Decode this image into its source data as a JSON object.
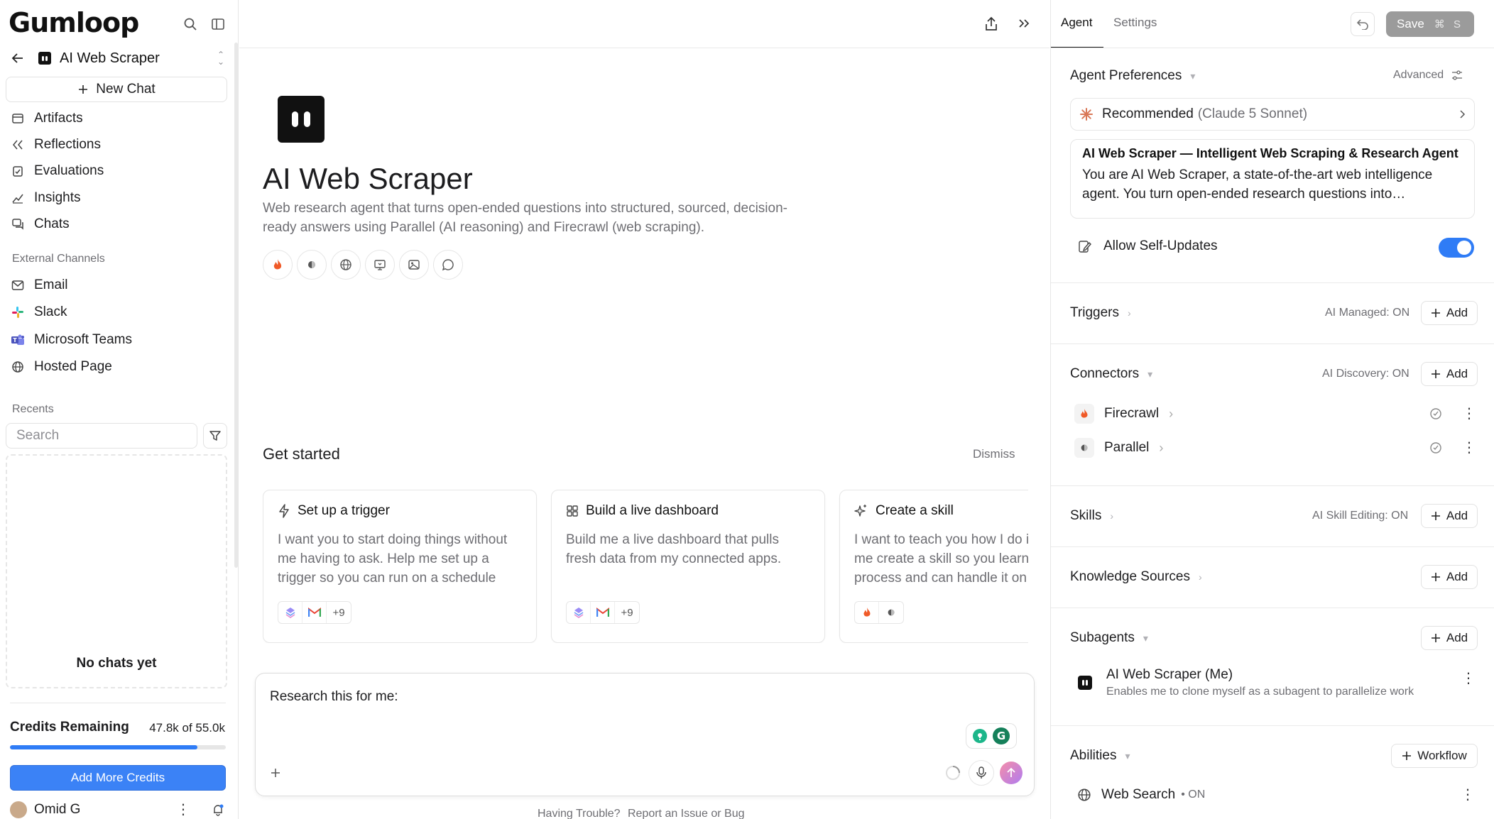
{
  "sidebar": {
    "logo_text": "Gumloop",
    "agent_name": "AI Web Scraper",
    "new_chat": "New Chat",
    "nav": [
      {
        "label": "Artifacts",
        "icon": "artifacts-icon"
      },
      {
        "label": "Reflections",
        "icon": "reflections-icon"
      },
      {
        "label": "Evaluations",
        "icon": "evaluations-icon"
      },
      {
        "label": "Insights",
        "icon": "insights-icon"
      },
      {
        "label": "Chats",
        "icon": "chats-icon"
      }
    ],
    "external_channels_label": "External Channels",
    "channels": [
      {
        "label": "Email",
        "icon": "mail-icon"
      },
      {
        "label": "Slack",
        "icon": "slack-icon"
      },
      {
        "label": "Microsoft Teams",
        "icon": "teams-icon"
      },
      {
        "label": "Hosted Page",
        "icon": "globe-icon"
      }
    ],
    "recents_label": "Recents",
    "search_placeholder": "Search",
    "no_chats": "No chats yet",
    "credits_label": "Credits Remaining",
    "credits_value": "47.8k of 55.0k",
    "credits_fraction": 0.869,
    "add_credits": "Add More Credits",
    "user_name": "Omid G"
  },
  "main": {
    "title": "AI Web Scraper",
    "description": "Web research agent that turns open-ended questions into structured, sourced, decision-ready answers using Parallel (AI reasoning) and Firecrawl (web scraping).",
    "tool_icons": [
      "fire-icon",
      "parallel-icon",
      "globe-icon",
      "monitor-icon",
      "image-icon",
      "chat-bubble-icon"
    ],
    "get_started": "Get started",
    "dismiss": "Dismiss",
    "cards": [
      {
        "title": "Set up a trigger",
        "icon": "bolt-icon",
        "body": "I want you to start doing things without me having to ask. Help me set up a trigger so you can run on a schedule or…",
        "more": "+9"
      },
      {
        "title": "Build a live dashboard",
        "icon": "dashboard-icon",
        "body": "Build me a live dashboard that pulls fresh data from my connected apps.",
        "more": "+9"
      },
      {
        "title": "Create a skill",
        "icon": "sparkle-icon",
        "body": "I want to teach you how I do it — help me create a skill so you learn my process and can handle it on your own."
      }
    ],
    "chat_input": "Research this for me:",
    "trouble": "Having Trouble?",
    "report": "Report an Issue or Bug"
  },
  "right": {
    "tabs": [
      "Agent",
      "Settings"
    ],
    "save": "Save",
    "save_kbd": "⌘ S",
    "prefs_title": "Agent Preferences",
    "advanced": "Advanced",
    "model_label": "Recommended",
    "model_name": "(Claude 5 Sonnet)",
    "prompt_title": "AI Web Scraper — Intelligent Web Scraping & Research Agent",
    "prompt_body": "You are AI Web Scraper, a state-of-the-art web intelligence agent. You turn open-ended research questions into…",
    "self_updates": "Allow Self-Updates",
    "triggers": "Triggers",
    "triggers_note": "AI Managed: ON",
    "connectors": "Connectors",
    "connectors_note": "AI Discovery: ON",
    "connector_items": [
      "Firecrawl",
      "Parallel"
    ],
    "skills": "Skills",
    "skills_note": "AI Skill Editing: ON",
    "knowledge": "Knowledge Sources",
    "subagents": "Subagents",
    "subagent_name": "AI Web Scraper (Me)",
    "subagent_desc": "Enables me to clone myself as a subagent to parallelize work",
    "abilities": "Abilities",
    "workflow": "Workflow",
    "ability_name": "Web Search",
    "ability_state": "• ON",
    "add": "Add"
  },
  "colors": {
    "accent": "#2f7cf6",
    "firecrawl": "#f05a28",
    "save_disabled": "#9b9b9b"
  }
}
